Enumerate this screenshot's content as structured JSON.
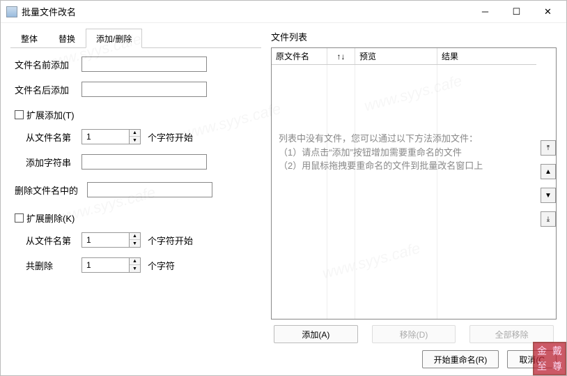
{
  "window": {
    "title": "批量文件改名"
  },
  "tabs": {
    "whole": "整体",
    "replace": "替换",
    "add_remove": "添加/删除"
  },
  "form": {
    "prefix_label": "文件名前添加",
    "prefix_value": "",
    "suffix_label": "文件名后添加",
    "suffix_value": "",
    "add_group": {
      "checkbox_label": "扩展添加(T)",
      "from_label": "从文件名第",
      "from_value": "1",
      "from_suffix": "个字符开始",
      "string_label": "添加字符串",
      "string_value": ""
    },
    "delete_in_name": {
      "label": "删除文件名中的",
      "value": ""
    },
    "del_group": {
      "checkbox_label": "扩展删除(K)",
      "from_label": "从文件名第",
      "from_value": "1",
      "from_suffix": "个字符开始",
      "count_label": "共删除",
      "count_value": "1",
      "count_suffix": "个字符"
    }
  },
  "filelist": {
    "title": "文件列表",
    "columns": {
      "name": "原文件名",
      "sort": "↑↓",
      "preview": "预览",
      "result": "结果"
    },
    "empty_lines": [
      "列表中没有文件，您可以通过以下方法添加文件：",
      "（1）请点击“添加”按钮增加需要重命名的文件",
      "（2）用鼠标拖拽要重命名的文件到批量改名窗口上"
    ],
    "side": {
      "top": "⤒",
      "up": "▲",
      "down": "▼",
      "bottom": "⤓"
    },
    "footer": {
      "add": "添加(A)",
      "remove": "移除(D)",
      "remove_all": "全部移除"
    }
  },
  "bottom": {
    "start": "开始重命名(R)",
    "cancel": "取消(C"
  },
  "watermark": "www.syys.cafe"
}
